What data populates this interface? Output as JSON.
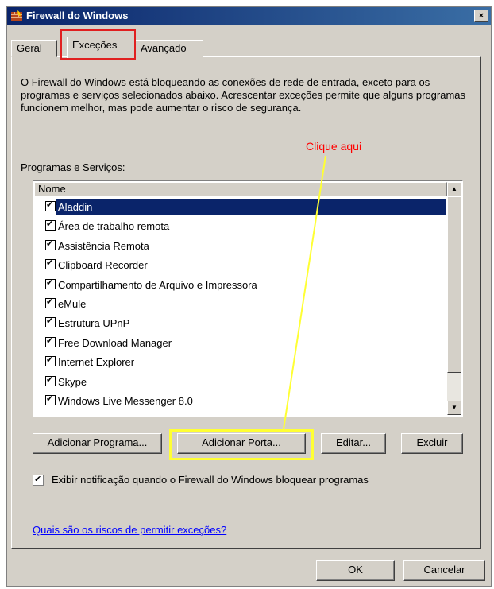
{
  "window": {
    "title": "Firewall do Windows",
    "close_label": "×"
  },
  "tabs": [
    {
      "label": "Geral",
      "active": false
    },
    {
      "label": "Exceções",
      "active": true
    },
    {
      "label": "Avançado",
      "active": false
    }
  ],
  "description": "O Firewall do Windows está bloqueando as conexões de rede de entrada, exceto para os programas e serviços selecionados abaixo. Acrescentar exceções permite que alguns programas funcionem melhor, mas pode aumentar o risco de segurança.",
  "annotation": {
    "callout_text": "Clique aqui",
    "callout_color": "#ff0000",
    "highlight_color": "#ffff33",
    "tab_highlight_color": "#e02020"
  },
  "programs": {
    "label": "Programas e Serviços:",
    "column_header": "Nome",
    "items": [
      {
        "name": "Aladdin",
        "checked": true,
        "selected": true
      },
      {
        "name": "Área de trabalho remota",
        "checked": true
      },
      {
        "name": "Assistência Remota",
        "checked": true
      },
      {
        "name": "Clipboard Recorder",
        "checked": true
      },
      {
        "name": "Compartilhamento de Arquivo e Impressora",
        "checked": true
      },
      {
        "name": "eMule",
        "checked": true
      },
      {
        "name": "Estrutura UPnP",
        "checked": true
      },
      {
        "name": "Free Download Manager",
        "checked": true
      },
      {
        "name": "Internet Explorer",
        "checked": true
      },
      {
        "name": "Skype",
        "checked": true
      },
      {
        "name": "Windows Live Messenger 8.0",
        "checked": true
      }
    ]
  },
  "buttons": {
    "add_program": "Adicionar Programa...",
    "add_port": "Adicionar Porta...",
    "edit": "Editar...",
    "delete": "Excluir",
    "ok": "OK",
    "cancel": "Cancelar"
  },
  "notify": {
    "checked": true,
    "label": "Exibir notificação quando o Firewall do Windows bloquear programas"
  },
  "risk_link": "Quais são os riscos de permitir exceções?"
}
